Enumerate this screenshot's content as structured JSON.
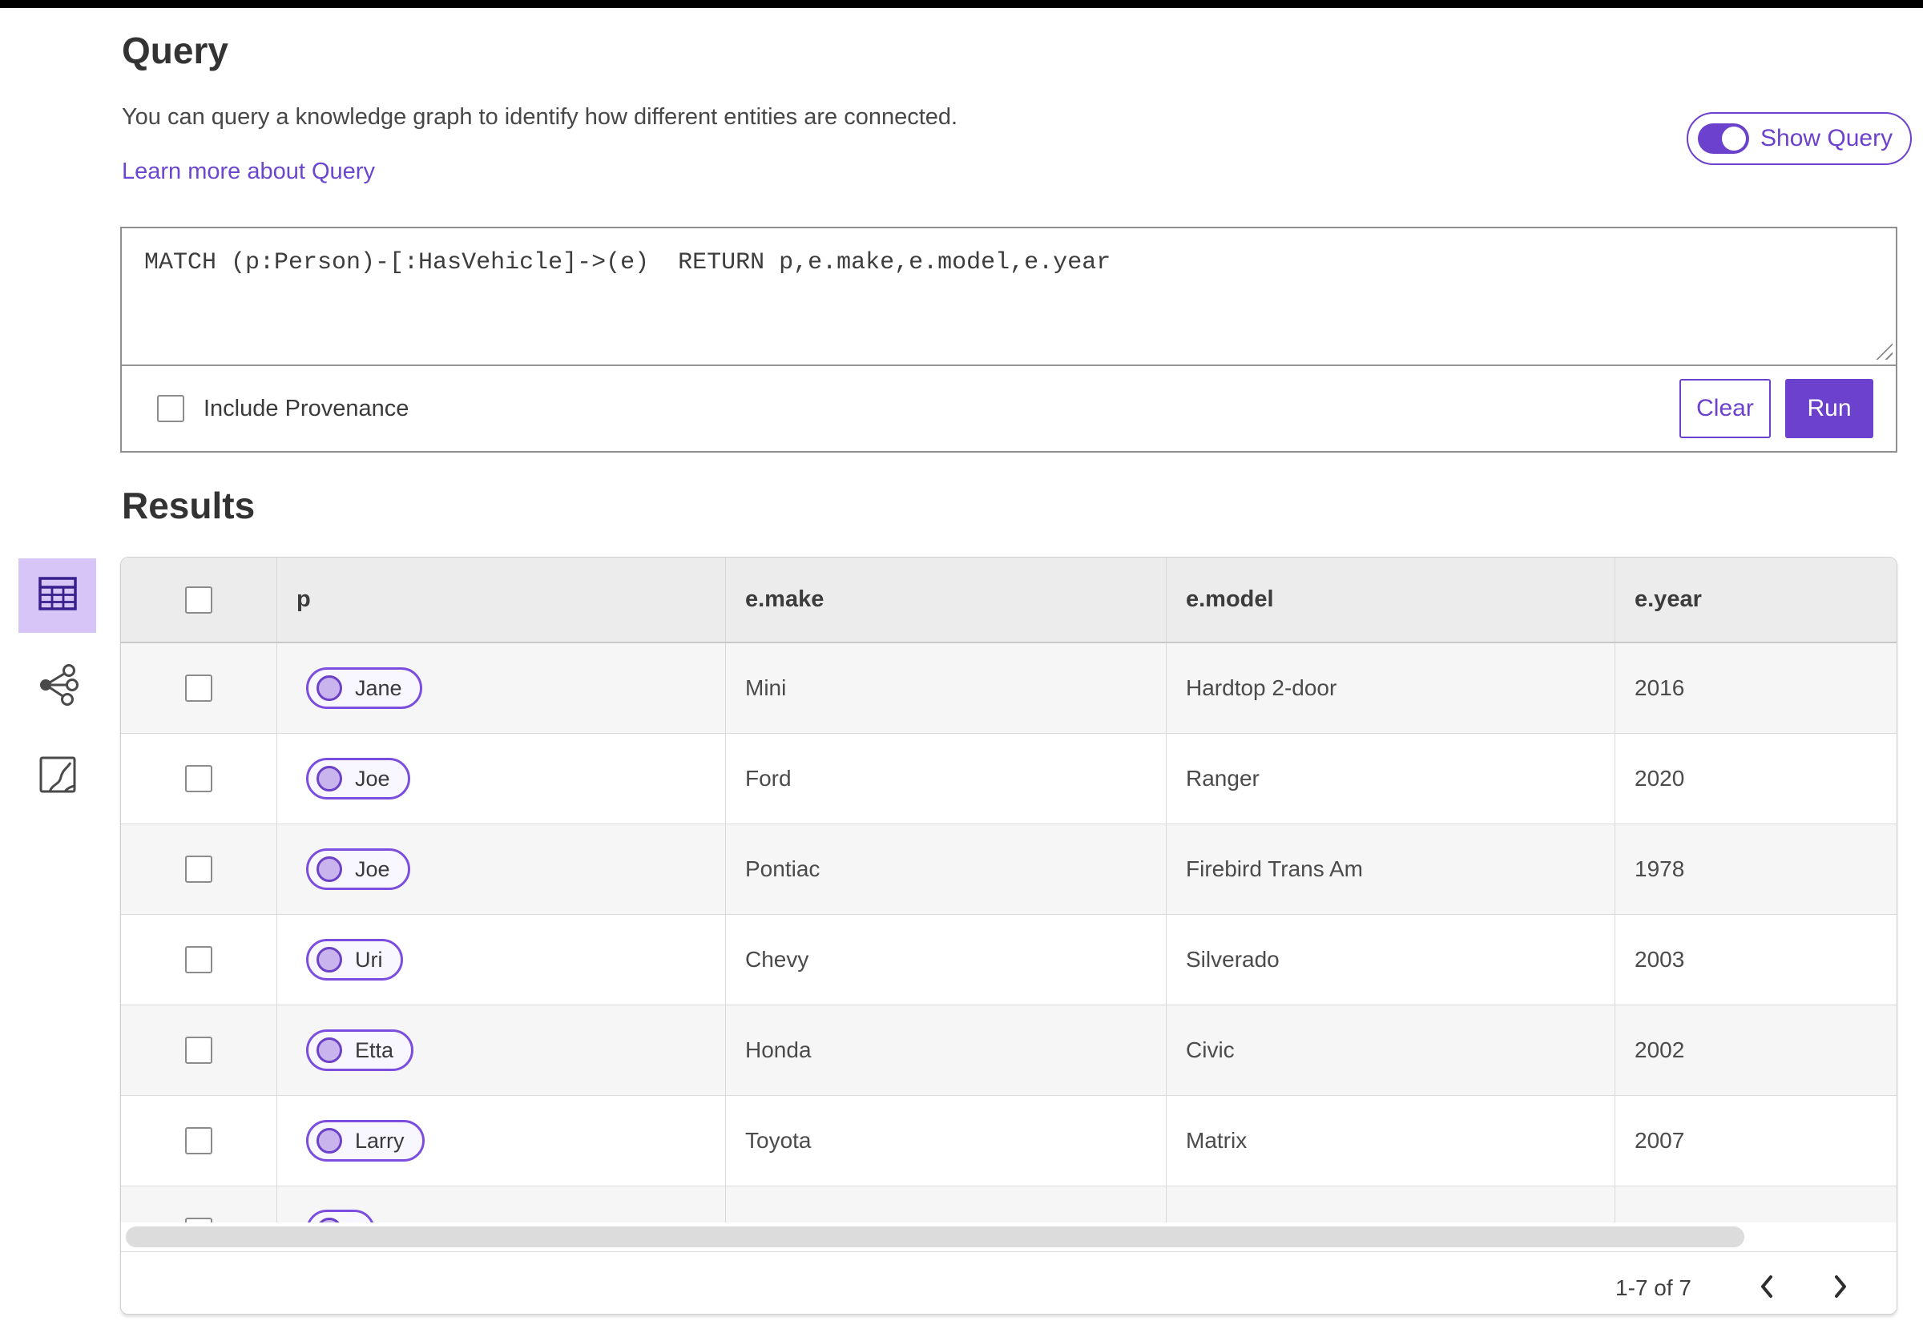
{
  "colors": {
    "accent_purple": "#6b41cd",
    "pill_border": "#7b4ee0",
    "pill_fill": "#f8f6fe",
    "pill_circle": "#c9b4ee",
    "selected_view_bg": "#d6c5f6",
    "header_row_bg": "#ececec",
    "row_alt_bg": "#f6f6f6",
    "top_bar": "#000000"
  },
  "query_section": {
    "title": "Query",
    "description": "You can query a knowledge graph to identify how different entities are connected.",
    "learn_more_link": "Learn more about Query",
    "show_query_toggle": {
      "label": "Show Query",
      "state": "on"
    },
    "editor": {
      "query_text": "MATCH (p:Person)-[:HasVehicle]->(e)  RETURN p,e.make,e.model,e.year"
    },
    "include_provenance": {
      "label": "Include Provenance",
      "checked": false
    },
    "buttons": {
      "clear": "Clear",
      "run": "Run"
    }
  },
  "results_section": {
    "title": "Results",
    "view_switcher": [
      {
        "name": "table-view",
        "selected": true
      },
      {
        "name": "graph-view",
        "selected": false
      },
      {
        "name": "map-view",
        "selected": false
      }
    ],
    "table": {
      "columns": [
        "p",
        "e.make",
        "e.model",
        "e.year"
      ],
      "rows": [
        {
          "p": "Jane",
          "make": "Mini",
          "model": "Hardtop 2-door",
          "year": "2016"
        },
        {
          "p": "Joe",
          "make": "Ford",
          "model": "Ranger",
          "year": "2020"
        },
        {
          "p": "Joe",
          "make": "Pontiac",
          "model": "Firebird Trans Am",
          "year": "1978"
        },
        {
          "p": "Uri",
          "make": "Chevy",
          "model": "Silverado",
          "year": "2003"
        },
        {
          "p": "Etta",
          "make": "Honda",
          "model": "Civic",
          "year": "2002"
        },
        {
          "p": "Larry",
          "make": "Toyota",
          "model": "Matrix",
          "year": "2007"
        }
      ],
      "partial_row_visible": true
    },
    "pagination": {
      "range_label": "1-7 of 7"
    }
  }
}
